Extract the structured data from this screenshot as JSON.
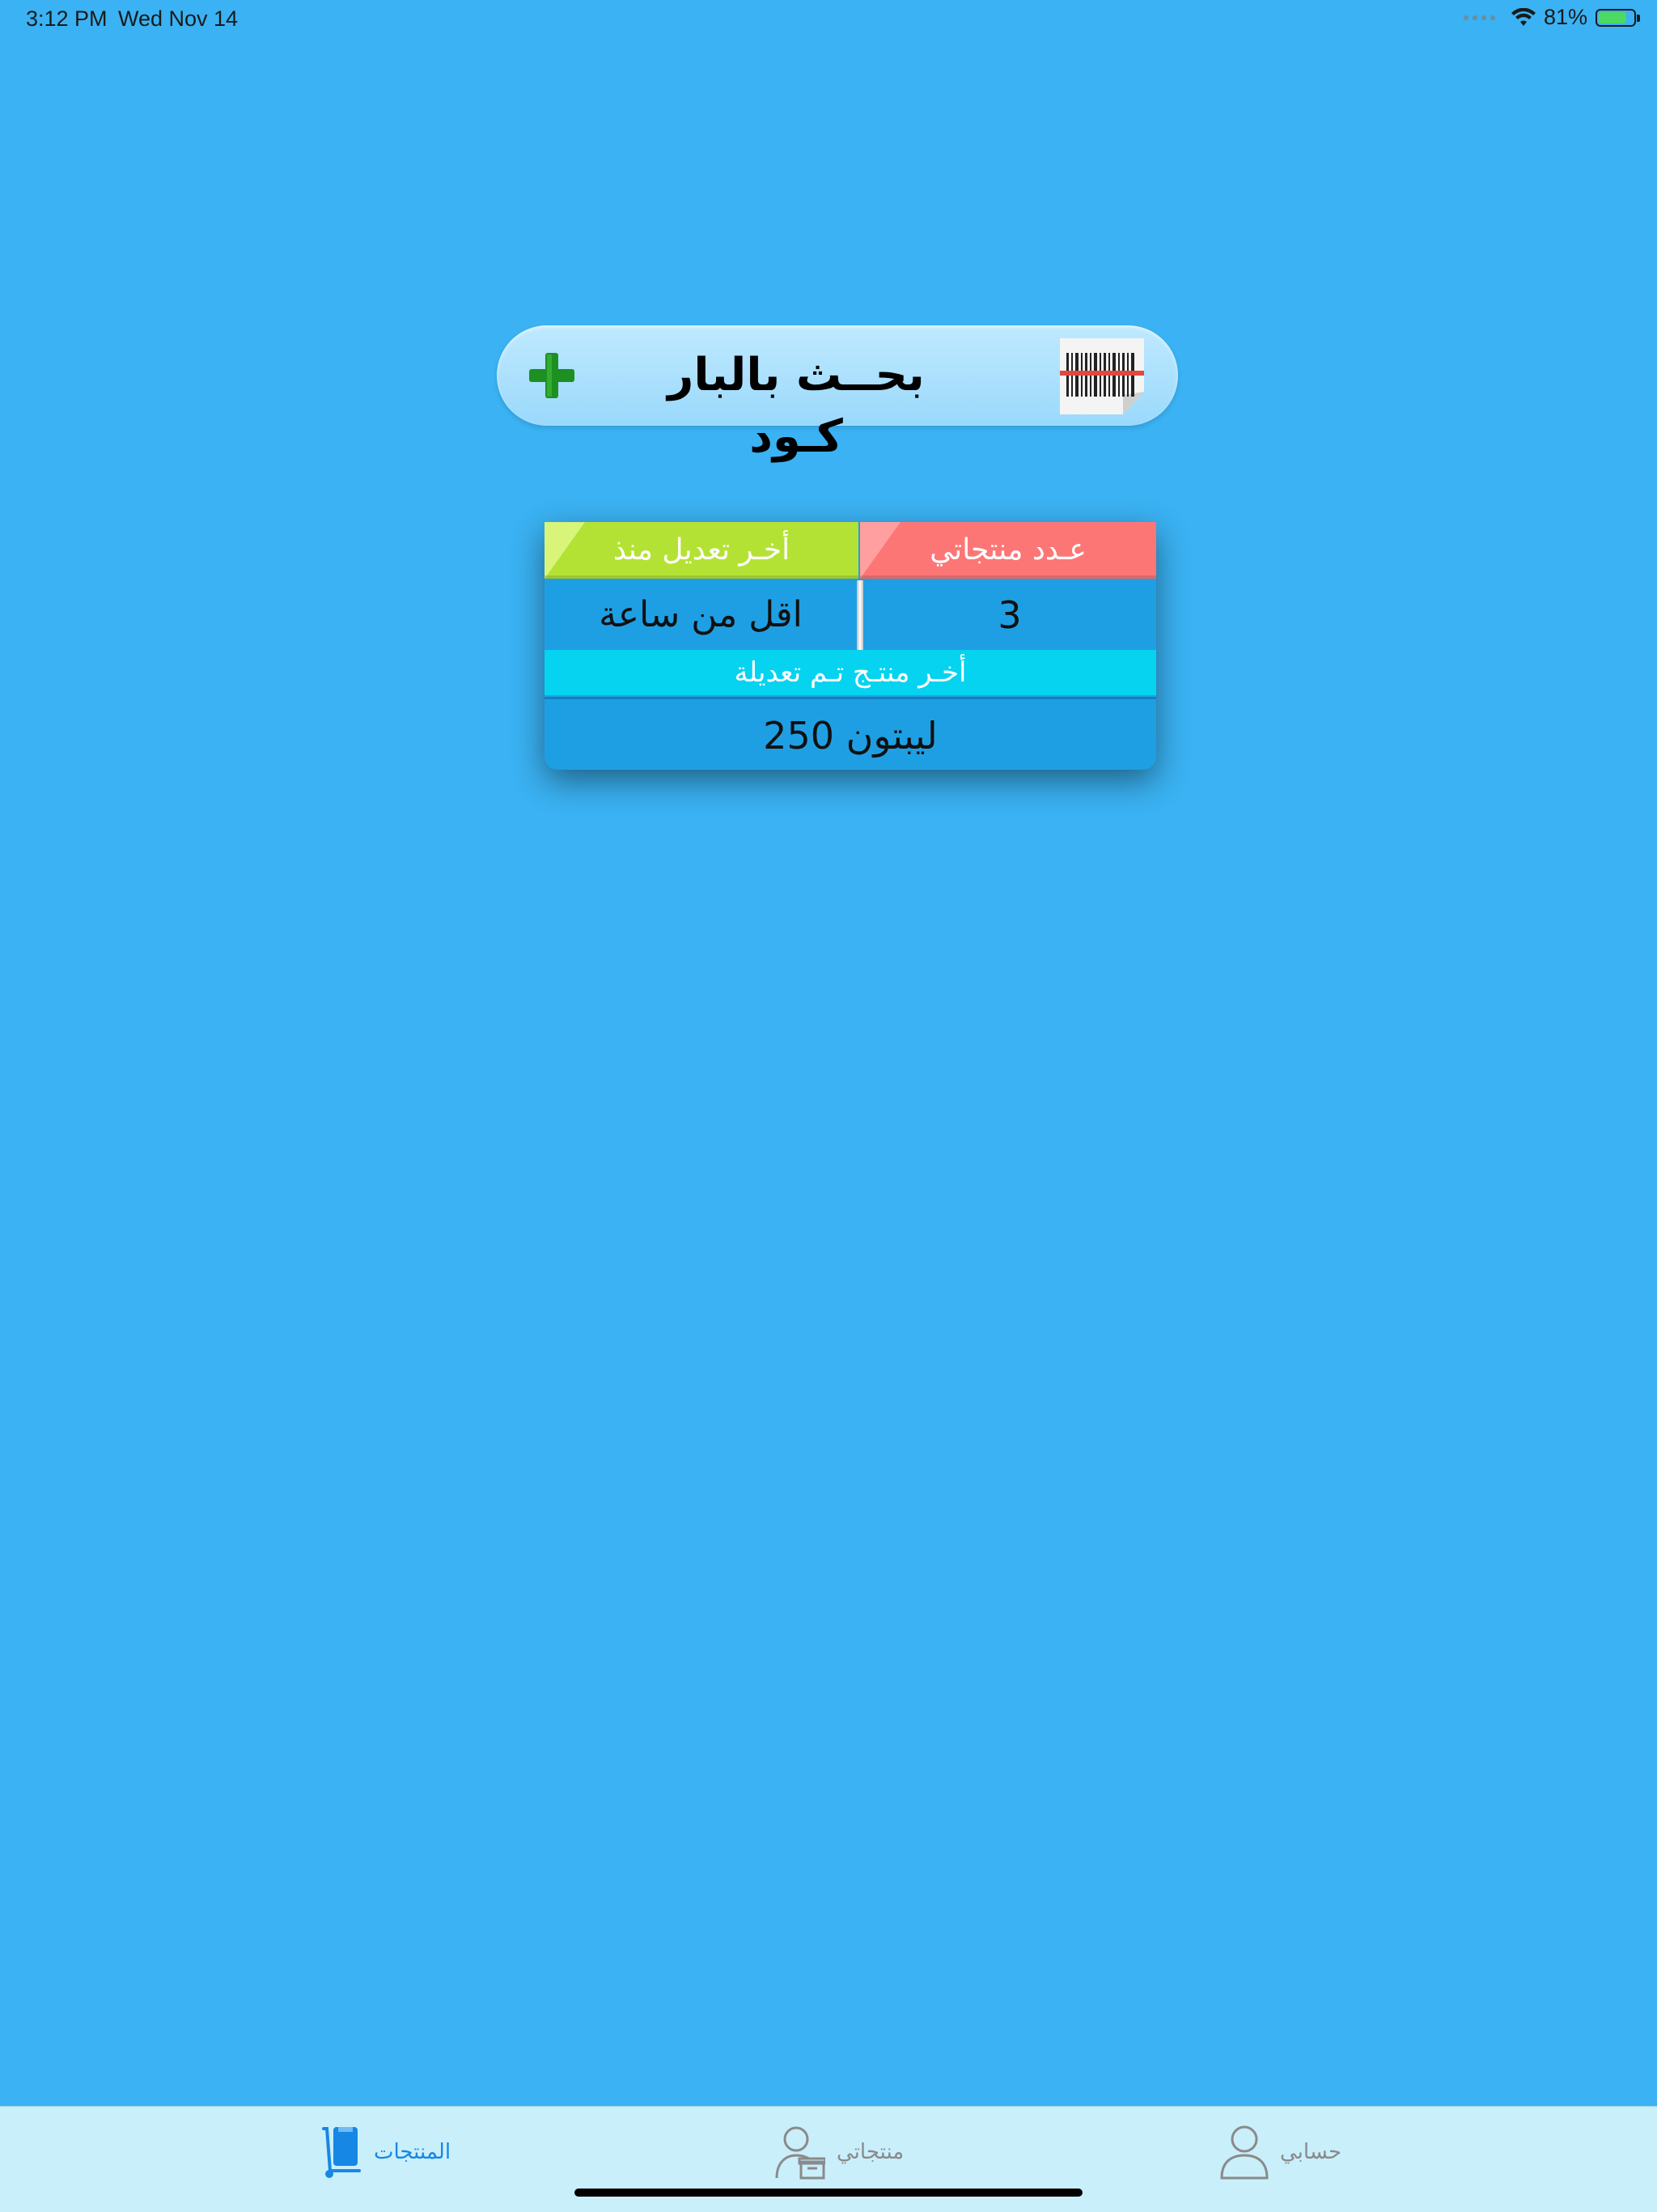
{
  "status_bar": {
    "time": "3:12 PM",
    "date": "Wed Nov 14",
    "battery_percent": "81%",
    "battery_level": 0.81,
    "icons": [
      "cellular-dots-icon",
      "wifi-icon",
      "battery-charging-icon"
    ]
  },
  "search": {
    "label": "بحــث بالبار كـود",
    "add_icon": "plus-icon",
    "barcode_icon": "barcode-icon"
  },
  "card": {
    "count_header": "عـدد منتجاتي",
    "count_value": "3",
    "last_edit_header": "أخـر تعديل منذ",
    "last_edit_value": "اقل من ساعة",
    "last_product_header": "أخـر منتـج تـم تعديلة",
    "last_product_value": "ليبتون 250"
  },
  "tab_bar": {
    "tabs": [
      {
        "label": "المنتجات",
        "icon": "cart-icon",
        "active": true
      },
      {
        "label": "منتجاتي",
        "icon": "user-box-icon",
        "active": false
      },
      {
        "label": "حسابي",
        "icon": "user-icon",
        "active": false
      }
    ],
    "active_color": "#1787e6",
    "inactive_color": "#8a8a8a"
  },
  "colors": {
    "background": "#3ab2f3",
    "count_header": "#fd7676",
    "last_edit_header": "#b4e234",
    "last_product_header": "#05d3f0",
    "card_body": "#1f9fe3",
    "tab_bar": "#c9effb"
  }
}
